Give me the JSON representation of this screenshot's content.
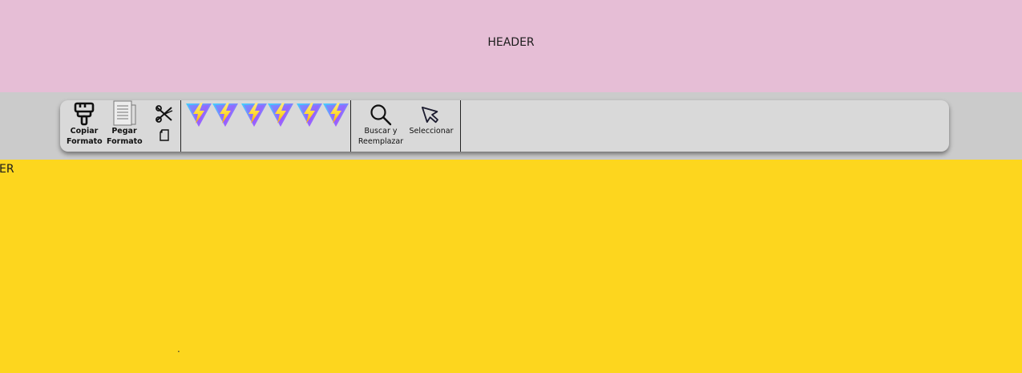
{
  "header": {
    "title": "HEADER"
  },
  "ribbon": {
    "copy_format": {
      "label": "Copiar\nFormato",
      "icon": "paintbrush-icon"
    },
    "paste_format": {
      "label": "Pegar\nFormato",
      "icon": "paste-document-icon"
    },
    "cut": {
      "icon": "scissors-icon"
    },
    "copy": {
      "icon": "copy-icon"
    },
    "vite_buttons": [
      {
        "icon": "vite-logo-icon"
      },
      {
        "icon": "vite-logo-icon"
      },
      {
        "icon": "vite-logo-icon"
      },
      {
        "icon": "vite-logo-icon"
      },
      {
        "icon": "vite-logo-icon"
      },
      {
        "icon": "vite-logo-icon"
      }
    ],
    "find_replace": {
      "label": "Buscar y\nReemplazar",
      "icon": "magnifier-icon"
    },
    "select": {
      "label": "Seleccionar",
      "icon": "cursor-arrow-icon"
    }
  },
  "content": {
    "text": "ER",
    "dot": "."
  },
  "colors": {
    "header_bg": "#e6bed6",
    "toolbar_bg": "#cbcbcb",
    "ribbon_bg": "#d9d9d9",
    "content_bg": "#fdd61e"
  }
}
